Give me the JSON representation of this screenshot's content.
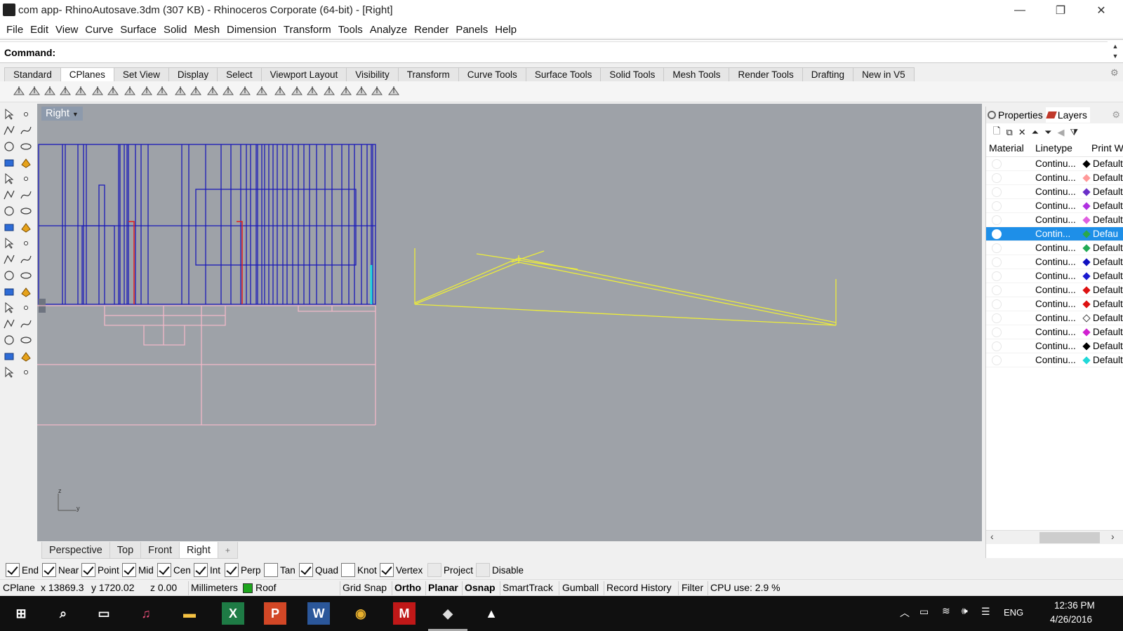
{
  "window": {
    "title": "com app- RhinoAutosave.3dm (307 KB) - Rhinoceros Corporate (64-bit) - [Right]",
    "minimize_glyph": "—",
    "restore_glyph": "❐",
    "close_glyph": "✕"
  },
  "menu": [
    "File",
    "Edit",
    "View",
    "Curve",
    "Surface",
    "Solid",
    "Mesh",
    "Dimension",
    "Transform",
    "Tools",
    "Analyze",
    "Render",
    "Panels",
    "Help"
  ],
  "command": {
    "label": "Command:",
    "value": ""
  },
  "toolbar_tabs": [
    {
      "label": "Standard",
      "active": false
    },
    {
      "label": "CPlanes",
      "active": true
    },
    {
      "label": "Set View",
      "active": false
    },
    {
      "label": "Display",
      "active": false
    },
    {
      "label": "Select",
      "active": false
    },
    {
      "label": "Viewport Layout",
      "active": false
    },
    {
      "label": "Visibility",
      "active": false
    },
    {
      "label": "Transform",
      "active": false
    },
    {
      "label": "Curve Tools",
      "active": false
    },
    {
      "label": "Surface Tools",
      "active": false
    },
    {
      "label": "Solid Tools",
      "active": false
    },
    {
      "label": "Mesh Tools",
      "active": false
    },
    {
      "label": "Render Tools",
      "active": false
    },
    {
      "label": "Drafting",
      "active": false
    },
    {
      "label": "New in V5",
      "active": false
    }
  ],
  "viewport": {
    "label": "Right",
    "bg": "#9ea2a8",
    "axis_z": "z",
    "axis_y": "y"
  },
  "view_tabs": [
    {
      "label": "Perspective",
      "active": false
    },
    {
      "label": "Top",
      "active": false
    },
    {
      "label": "Front",
      "active": false
    },
    {
      "label": "Right",
      "active": true
    },
    {
      "label": "+",
      "active": false
    }
  ],
  "panel": {
    "tabs": [
      "Properties",
      "Layers"
    ],
    "columns": {
      "material": "Material",
      "linetype": "Linetype",
      "print_width": "Print W"
    },
    "layers": [
      {
        "linetype": "Continu...",
        "color": "#000000",
        "print_width": "Default",
        "selected": false
      },
      {
        "linetype": "Continu...",
        "color": "#ff9999",
        "print_width": "Default",
        "selected": false
      },
      {
        "linetype": "Continu...",
        "color": "#6a2fc8",
        "print_width": "Default",
        "selected": false
      },
      {
        "linetype": "Continu...",
        "color": "#b030e0",
        "print_width": "Default",
        "selected": false
      },
      {
        "linetype": "Continu...",
        "color": "#e060e0",
        "print_width": "Default",
        "selected": false
      },
      {
        "linetype": "Contin...",
        "color": "#2aa84a",
        "print_width": "Defau",
        "selected": true
      },
      {
        "linetype": "Continu...",
        "color": "#22aa55",
        "print_width": "Default",
        "selected": false
      },
      {
        "linetype": "Continu...",
        "color": "#1010c0",
        "print_width": "Default",
        "selected": false
      },
      {
        "linetype": "Continu...",
        "color": "#1a1ad0",
        "print_width": "Default",
        "selected": false
      },
      {
        "linetype": "Continu...",
        "color": "#dd1111",
        "print_width": "Default",
        "selected": false
      },
      {
        "linetype": "Continu...",
        "color": "#dd1111",
        "print_width": "Default",
        "selected": false
      },
      {
        "linetype": "Continu...",
        "color": "#ffffff",
        "print_width": "Default",
        "selected": false
      },
      {
        "linetype": "Continu...",
        "color": "#d020d0",
        "print_width": "Default",
        "selected": false
      },
      {
        "linetype": "Continu...",
        "color": "#000000",
        "print_width": "Default",
        "selected": false
      },
      {
        "linetype": "Continu...",
        "color": "#20d8d8",
        "print_width": "Default",
        "selected": false
      }
    ]
  },
  "osnaps": [
    {
      "label": "End",
      "checked": true
    },
    {
      "label": "Near",
      "checked": true
    },
    {
      "label": "Point",
      "checked": true
    },
    {
      "label": "Mid",
      "checked": true
    },
    {
      "label": "Cen",
      "checked": true
    },
    {
      "label": "Int",
      "checked": true
    },
    {
      "label": "Perp",
      "checked": true
    },
    {
      "label": "Tan",
      "checked": false
    },
    {
      "label": "Quad",
      "checked": true
    },
    {
      "label": "Knot",
      "checked": false
    },
    {
      "label": "Vertex",
      "checked": true
    },
    {
      "label": "Project",
      "checked": false,
      "disabled": true
    },
    {
      "label": "Disable",
      "checked": false,
      "disabled": true
    }
  ],
  "status": {
    "cplane": "CPlane",
    "x": "x 13869.3",
    "y": "y 1720.02",
    "z": "z 0.00",
    "units": "Millimeters",
    "layer": "Roof",
    "layer_color": "#1da51d",
    "grid_snap": "Grid Snap",
    "ortho": "Ortho",
    "planar": "Planar",
    "osnap": "Osnap",
    "smarttrack": "SmartTrack",
    "gumball": "Gumball",
    "record_history": "Record History",
    "filter": "Filter",
    "cpu": "CPU use: 2.9 %"
  },
  "taskbar": {
    "apps": [
      "start",
      "search",
      "task-view",
      "itunes",
      "file-explorer",
      "excel",
      "powerpoint",
      "word",
      "chrome",
      "mcafee",
      "rhino",
      "photos"
    ],
    "lang": "ENG",
    "time": "12:36 PM",
    "date": "4/26/2016"
  }
}
